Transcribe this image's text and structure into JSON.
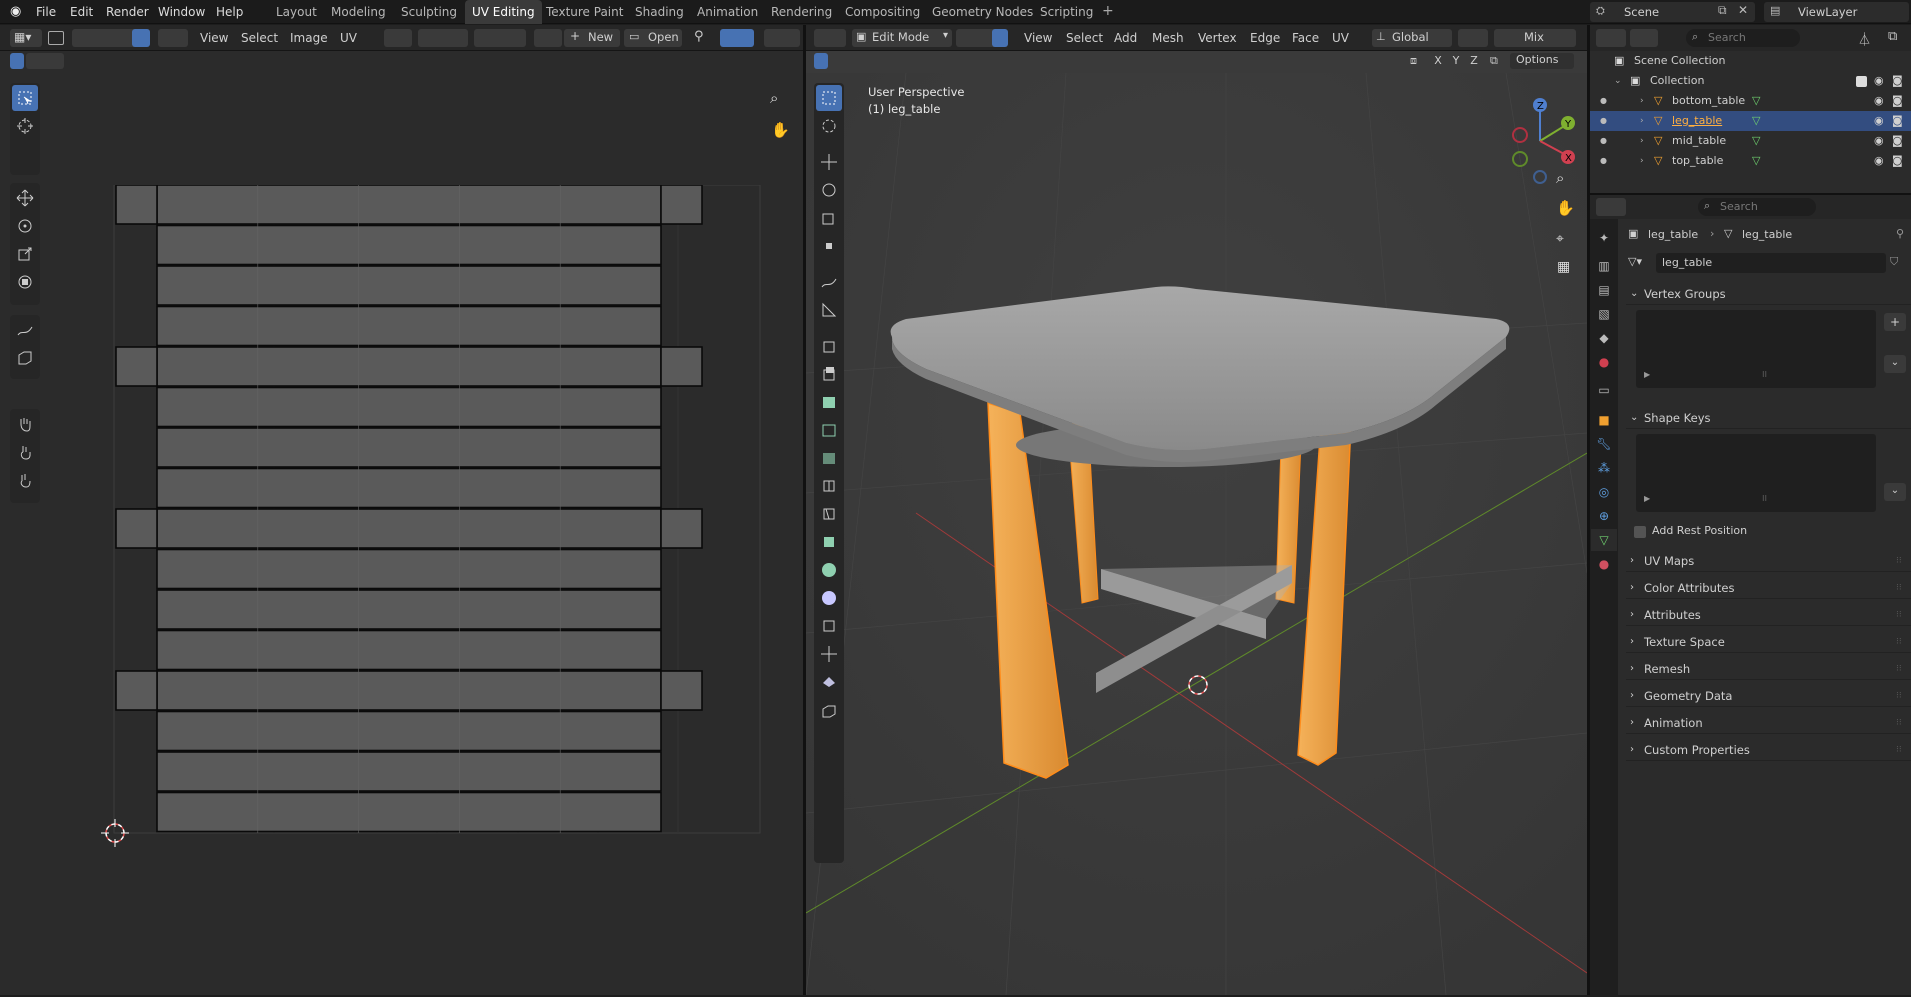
{
  "menus": [
    "File",
    "Edit",
    "Render",
    "Window",
    "Help"
  ],
  "workspaces": [
    "Layout",
    "Modeling",
    "Sculpting",
    "UV Editing",
    "Texture Paint",
    "Shading",
    "Animation",
    "Rendering",
    "Compositing",
    "Geometry Nodes",
    "Scripting"
  ],
  "active_workspace": "UV Editing",
  "scene": {
    "label": "Scene",
    "viewlayer": "ViewLayer"
  },
  "uv_editor": {
    "menus": [
      "View",
      "Select",
      "Image",
      "UV"
    ],
    "new_label": "New",
    "open_label": "Open"
  },
  "viewport": {
    "mode": "Edit Mode",
    "menus": [
      "View",
      "Select",
      "Add",
      "Mesh",
      "Vertex",
      "Edge",
      "Face",
      "UV"
    ],
    "orientation": "Global",
    "mix": "Mix",
    "options": "Options",
    "overlay_title": "User Perspective",
    "overlay_object": "(1) leg_table",
    "axes": [
      "X",
      "Y",
      "Z"
    ]
  },
  "outliner": {
    "search_placeholder": "Search",
    "scene_collection": "Scene Collection",
    "collection": "Collection",
    "items": [
      "bottom_table",
      "leg_table",
      "mid_table",
      "top_table"
    ],
    "selected": "leg_table"
  },
  "properties": {
    "search_placeholder": "Search",
    "breadcrumb_object": "leg_table",
    "breadcrumb_data": "leg_table",
    "data_name": "leg_table",
    "vertex_groups": "Vertex Groups",
    "shape_keys": "Shape Keys",
    "add_rest_position": "Add Rest Position",
    "sections": [
      "UV Maps",
      "Color Attributes",
      "Attributes",
      "Texture Space",
      "Remesh",
      "Geometry Data",
      "Animation",
      "Custom Properties"
    ]
  },
  "colors": {
    "accent": "#4772b3",
    "selection_orange": "#f0a030",
    "active_orange": "#ff8c1a"
  }
}
